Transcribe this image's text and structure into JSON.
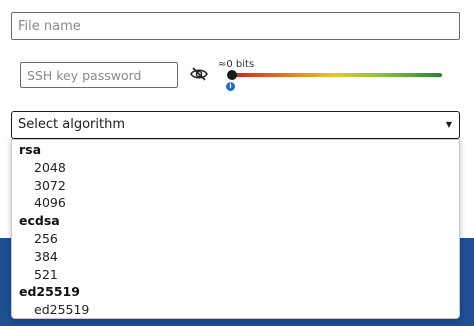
{
  "file_name": {
    "placeholder": "File name"
  },
  "ssh_password": {
    "placeholder": "SSH key password"
  },
  "password_visibility": {
    "icon": "eye-slash-icon"
  },
  "strength": {
    "label": "≈0 bits",
    "value": 0,
    "info_icon": "info-icon"
  },
  "algorithm_select": {
    "label": "Select algorithm",
    "arrow_icon": "caret-down-icon",
    "groups": [
      {
        "label": "rsa",
        "options": [
          "2048",
          "3072",
          "4096"
        ]
      },
      {
        "label": "ecdsa",
        "options": [
          "256",
          "384",
          "521"
        ]
      },
      {
        "label": "ed25519",
        "options": [
          "ed25519"
        ]
      }
    ]
  },
  "colors": {
    "background_band": "#1f4f93",
    "strength_start": "#d21f1f",
    "strength_end": "#1e8a2e",
    "info": "#1d6fce"
  }
}
